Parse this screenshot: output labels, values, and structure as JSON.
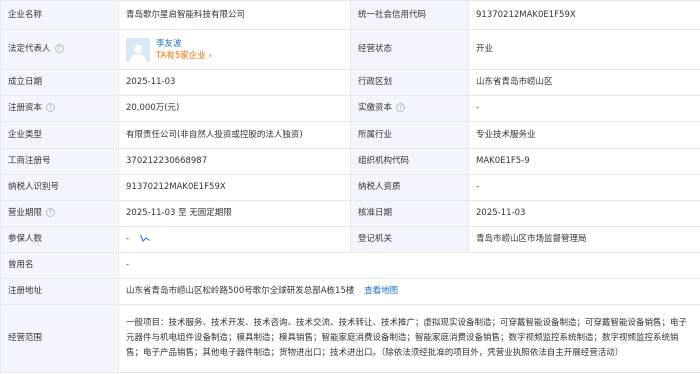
{
  "company_name": {
    "label": "企业名称",
    "value": "青岛歌尔星启智能科技有限公司"
  },
  "credit_code": {
    "label": "统一社会信用代码",
    "value": "91370212MAK0E1F59X"
  },
  "legal_rep": {
    "label": "法定代表人",
    "name": "李友波",
    "link": "TA有5家企业",
    "link_arrow": "›"
  },
  "status": {
    "label": "经营状态",
    "value": "开业"
  },
  "founded": {
    "label": "成立日期",
    "value": "2025-11-03"
  },
  "region": {
    "label": "行政区划",
    "value": "山东省青岛市崂山区"
  },
  "capital": {
    "label": "注册资本",
    "value": "20,000万(元)"
  },
  "paid_capital": {
    "label": "实缴资本",
    "value": "-"
  },
  "company_type": {
    "label": "企业类型",
    "value": "有限责任公司(非自然人投资或控股的法人独资)"
  },
  "industry": {
    "label": "所属行业",
    "value": "专业技术服务业"
  },
  "reg_no": {
    "label": "工商注册号",
    "value": "370212230668987"
  },
  "org_code": {
    "label": "组织机构代码",
    "value": "MAK0E1F5-9"
  },
  "taxpayer_id": {
    "label": "纳税人识别号",
    "value": "91370212MAK0E1F59X"
  },
  "taxpayer_qual": {
    "label": "纳税人资质",
    "value": "-"
  },
  "term": {
    "label": "营业期限",
    "value": "2025-11-03 至 无固定期限"
  },
  "approved": {
    "label": "核准日期",
    "value": "2025-11-03"
  },
  "insured": {
    "label": "参保人数",
    "value": "-",
    "trend_icon": "trend-icon"
  },
  "authority": {
    "label": "登记机关",
    "value": "青岛市崂山区市场监督管理局"
  },
  "former_name": {
    "label": "曾用名",
    "value": "-"
  },
  "address": {
    "label": "注册地址",
    "value": "山东省青岛市崂山区松岭路500号歌尔全球研发总部A栋15楼",
    "map_link": "查看地图"
  },
  "scope": {
    "label": "经营范围",
    "value": "一般项目：技术服务、技术开发、技术咨询、技术交流、技术转让、技术推广；虚拟现实设备制造；可穿戴智能设备制造；可穿戴智能设备销售；电子元器件与机电组件设备制造；模具制造；模具销售；智能家庭消费设备制造；智能家庭消费设备销售；数字视频监控系统制造；数字视频监控系统销售；电子产品销售；其他电子器件制造；货物进出口；技术进出口。（除依法须经批准的项目外，凭营业执照依法自主开展经营活动）"
  },
  "help_glyph": "?",
  "colors": {
    "label_bg": "#f2f6fc",
    "border": "#e4e8ef",
    "link": "#1f6fd1",
    "accent": "#ff6a00"
  }
}
